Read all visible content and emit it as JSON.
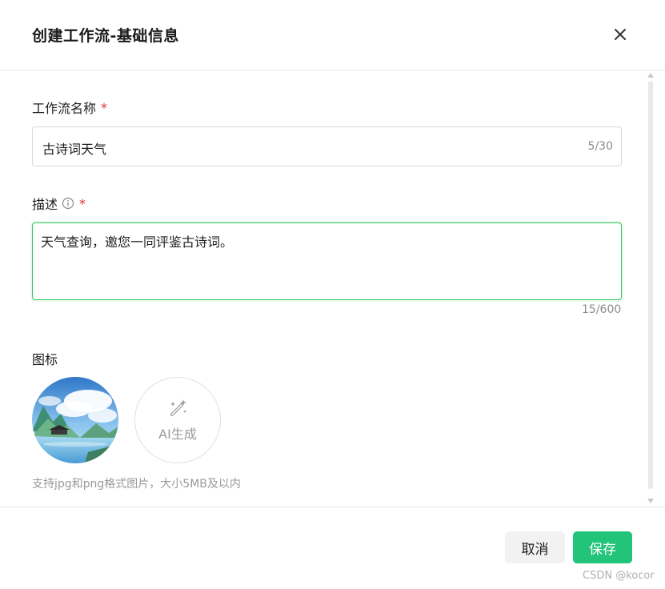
{
  "dialog": {
    "title": "创建工作流-基础信息"
  },
  "form": {
    "name": {
      "label": "工作流名称",
      "required_mark": "*",
      "value": "古诗词天气",
      "counter": "5/30"
    },
    "description": {
      "label": "描述",
      "required_mark": "*",
      "value": "天气查询，邀您一同评鉴古诗词。",
      "counter": "15/600"
    },
    "icon": {
      "label": "图标",
      "ai_generate_label": "AI生成",
      "hint": "支持jpg和png格式图片，大小5MB及以内"
    }
  },
  "footer": {
    "cancel_label": "取消",
    "save_label": "保存",
    "watermark": "CSDN @kocor"
  },
  "colors": {
    "accent": "#22c47a",
    "focus_border": "#34c759",
    "required": "#e03131"
  }
}
